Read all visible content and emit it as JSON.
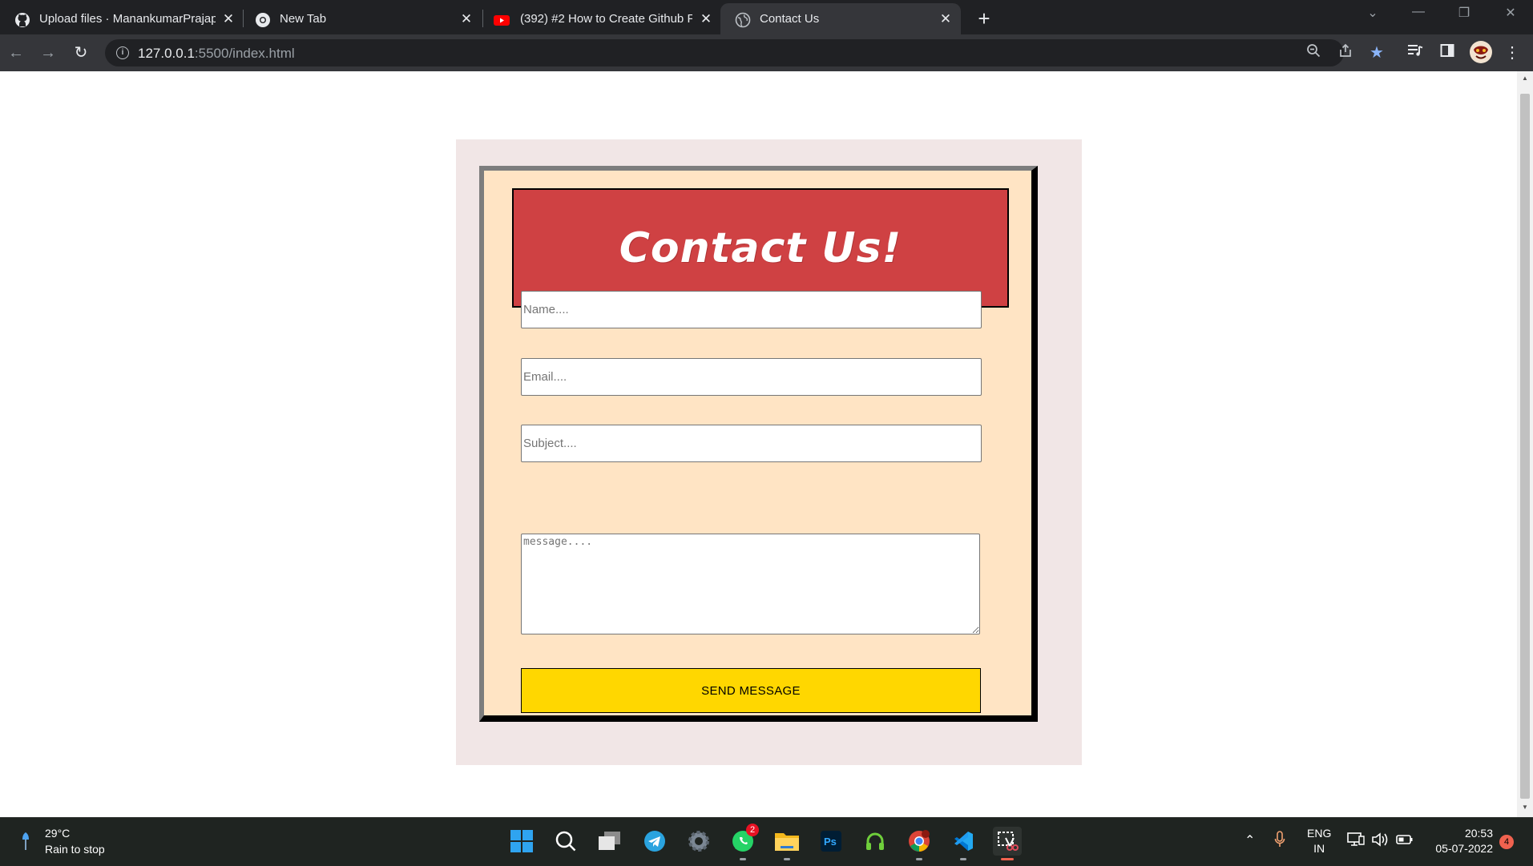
{
  "browser": {
    "tabs": [
      {
        "title": "Upload files · ManankumarPrajap",
        "favicon": "github-icon"
      },
      {
        "title": "New Tab",
        "favicon": "chrome-icon"
      },
      {
        "title": "(392) #2 How to Create Github Fr",
        "favicon": "youtube-icon"
      },
      {
        "title": "Contact Us",
        "favicon": "globe-icon"
      }
    ],
    "active_tab": 3,
    "address": {
      "host": "127.0.0.1",
      "path": ":5500/index.html"
    }
  },
  "page": {
    "heading": "Contact Us!",
    "form": {
      "name_placeholder": "Name....",
      "email_placeholder": "Email....",
      "subject_placeholder": "Subject....",
      "message_placeholder": "message....",
      "submit_label": "SEND MESSAGE"
    }
  },
  "taskbar": {
    "weather": {
      "temp": "29°C",
      "desc": "Rain to stop"
    },
    "whatsapp_badge": "2",
    "language": {
      "line1": "ENG",
      "line2": "IN"
    },
    "clock": {
      "time": "20:53",
      "date": "05-07-2022"
    },
    "notification_count": "4"
  },
  "colors": {
    "banner": "#cf4143",
    "form_bg": "#ffe4c4",
    "outer_bg": "#f1e6e6",
    "button": "#ffd700"
  }
}
